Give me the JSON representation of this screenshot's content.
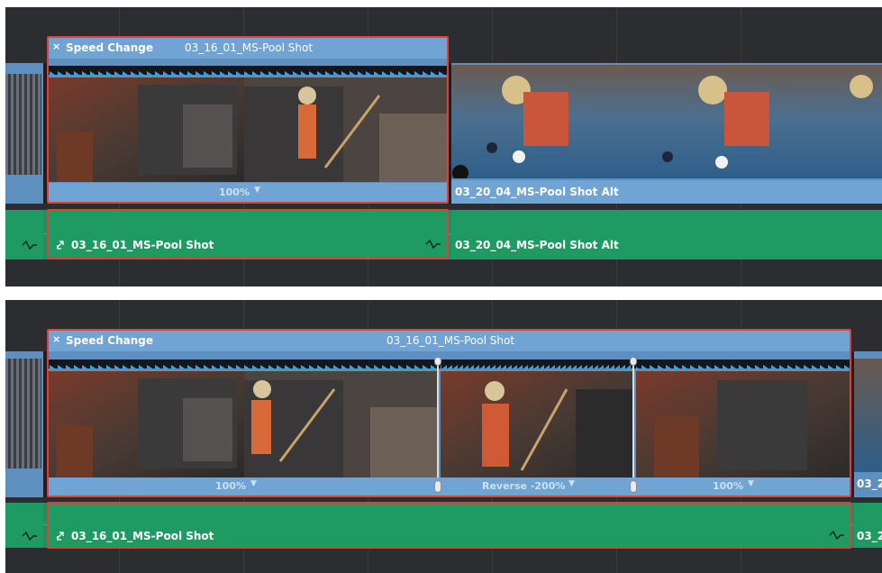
{
  "top_timeline": {
    "speed_change_label": "Speed Change",
    "selected_clip_name": "03_16_01_MS-Pool Shot",
    "selected_clip_speed": "100%",
    "next_clip_name": "03_20_04_MS-Pool Shot Alt",
    "audio_clip_name": "03_16_01_MS-Pool Shot",
    "next_audio_clip_name": "03_20_04_MS-Pool Shot Alt"
  },
  "bottom_timeline": {
    "speed_change_label": "Speed Change",
    "selected_clip_name": "03_16_01_MS-Pool Shot",
    "segments": [
      {
        "speed": "100%"
      },
      {
        "speed": "Reverse -200%"
      },
      {
        "speed": "100%"
      }
    ],
    "next_clip_name_truncated": "03_2",
    "audio_clip_name": "03_16_01_MS-Pool Shot",
    "next_audio_clip_name_truncated": "03_2"
  },
  "colors": {
    "selection": "#e0403a",
    "video_clip": "#6fa4d4",
    "audio_clip": "#1f9a63",
    "keyframe_arrow": "#29a8e8"
  }
}
